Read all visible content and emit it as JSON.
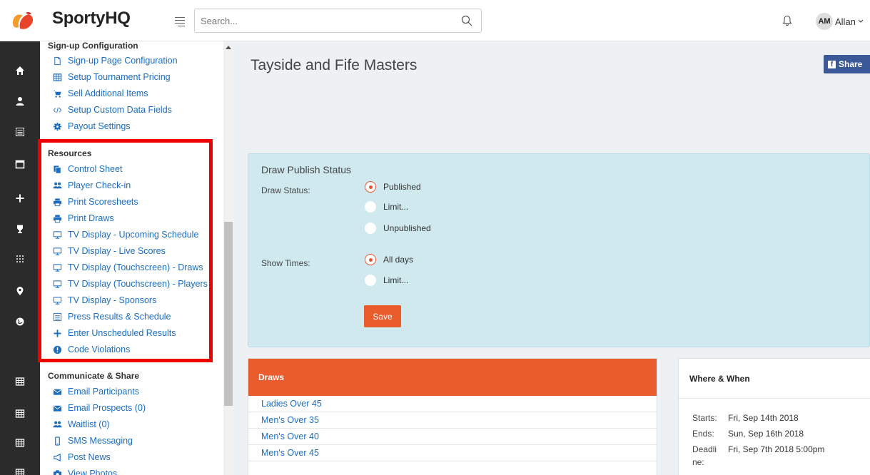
{
  "brand": {
    "name": "SportyHQ",
    "logo_icon": "sportyhq-logo-icon",
    "accent": "#ea5c2b",
    "link_color": "#1b6dc1"
  },
  "search": {
    "placeholder": "Search..."
  },
  "user": {
    "initials": "AM",
    "name": "Allan"
  },
  "rail": [
    "home-icon",
    "user-icon",
    "list-icon",
    "calendar-icon",
    "plus-icon",
    "trophy-icon",
    "grid-dots-icon",
    "map-pin-icon",
    "globe-icon",
    "table-icon",
    "table-icon",
    "table-icon",
    "table-icon"
  ],
  "sidebar": {
    "signup": {
      "heading": "Sign-up Configuration",
      "items": [
        {
          "label": "Sign-up Page Configuration",
          "icon": "file-icon"
        },
        {
          "label": "Setup Tournament Pricing",
          "icon": "table-icon"
        },
        {
          "label": "Sell Additional Items",
          "icon": "cart-icon"
        },
        {
          "label": "Setup Custom Data Fields",
          "icon": "code-icon"
        },
        {
          "label": "Payout Settings",
          "icon": "gear-icon"
        }
      ]
    },
    "resources": {
      "heading": "Resources",
      "items": [
        {
          "label": "Control Sheet",
          "icon": "copy-icon"
        },
        {
          "label": "Player Check-in",
          "icon": "users-icon"
        },
        {
          "label": "Print Scoresheets",
          "icon": "print-icon"
        },
        {
          "label": "Print Draws",
          "icon": "print-icon"
        },
        {
          "label": "TV Display - Upcoming Schedule",
          "icon": "monitor-icon"
        },
        {
          "label": "TV Display - Live Scores",
          "icon": "monitor-icon"
        },
        {
          "label": "TV Display (Touchscreen) - Draws",
          "icon": "monitor-icon"
        },
        {
          "label": "TV Display (Touchscreen) - Players",
          "icon": "monitor-icon"
        },
        {
          "label": "TV Display - Sponsors",
          "icon": "monitor-icon"
        },
        {
          "label": "Press Results & Schedule",
          "icon": "list-icon"
        },
        {
          "label": "Enter Unscheduled Results",
          "icon": "plus-icon"
        },
        {
          "label": "Code Violations",
          "icon": "alert-icon"
        }
      ]
    },
    "communicate": {
      "heading": "Communicate & Share",
      "items": [
        {
          "label": "Email Participants",
          "icon": "envelope-icon"
        },
        {
          "label": "Email Prospects (0)",
          "icon": "envelope-icon"
        },
        {
          "label": "Waitlist (0)",
          "icon": "users-icon"
        },
        {
          "label": "SMS Messaging",
          "icon": "phone-icon"
        },
        {
          "label": "Post News",
          "icon": "megaphone-icon"
        },
        {
          "label": "View Photos",
          "icon": "camera-icon"
        }
      ]
    }
  },
  "main": {
    "title": "Tayside and Fife Masters",
    "share_label": "Share",
    "publish": {
      "title": "Draw Publish Status",
      "draw_status_label": "Draw Status:",
      "draw_status_options": [
        {
          "label": "Published",
          "selected": true
        },
        {
          "label": "Limit...",
          "selected": false
        },
        {
          "label": "Unpublished",
          "selected": false
        }
      ],
      "show_times_label": "Show Times:",
      "show_times_options": [
        {
          "label": "All days",
          "selected": true
        },
        {
          "label": "Limit...",
          "selected": false
        }
      ],
      "save_label": "Save"
    },
    "draws": {
      "header": "Draws",
      "items": [
        "Ladies Over 45",
        "Men's Over 35",
        "Men's Over 40",
        "Men's Over 45"
      ]
    },
    "when": {
      "header": "Where & When",
      "starts_label": "Starts:",
      "starts_value": "Fri, Sep 14th 2018",
      "ends_label": "Ends:",
      "ends_value": "Sun, Sep 16th 2018",
      "deadline_label": "Deadli ne:",
      "deadline_value": "Fri, Sep 7th 2018 5:00pm"
    }
  }
}
